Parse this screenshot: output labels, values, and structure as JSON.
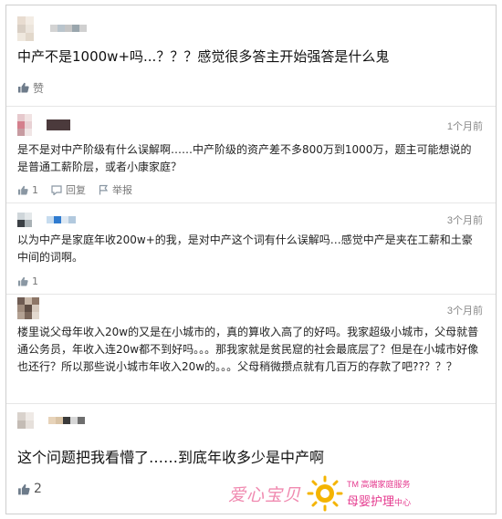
{
  "colors": {
    "accent_pink": "#e5398e",
    "watermark_pink": "#f08ab0",
    "logo_yellow": "#f4b400",
    "muted": "#888888"
  },
  "comments": [
    {
      "text": "中产不是1000w+吗...？？？感觉很多答主开始强答是什么鬼",
      "like_icon": "thumbs-up-icon",
      "like_label": "赞"
    },
    {
      "time": "1个月前",
      "text": "是不是对中产阶级有什么误解啊……中产阶级的资产差不多800万到1000万，题主可能想说的是普通工薪阶层，或者小康家庭？",
      "like_count": "1",
      "reply_label": "回复",
      "report_label": "举报"
    },
    {
      "time": "3个月前",
      "text": "以为中产是家庭年收200w+的我，是对中产这个词有什么误解吗…感觉中产是夹在工薪和土豪中间的词啊。",
      "like_count": "1"
    },
    {
      "time": "3个月前",
      "text": "楼里说父母年收入20w的又是在小城市的，真的算收入高了的好吗。我家超级小城市，父母就普通公务员，年收入连20w都不到好吗。。。那我家就是贫民窟的社会最底层了？但是在小城市好像也还行？所以那些说小城市年收入20w的。。。父母稍微攒点就有几百万的存款了吧??？？？"
    },
    {
      "text": "这个问题把我看懵了……到底年收多少是中产啊",
      "like_count": "2"
    }
  ],
  "watermark": {
    "brand": "爱心宝贝",
    "tm_line": "TM 高端家庭服务",
    "service": "母婴护理",
    "service_suffix": "中心"
  }
}
